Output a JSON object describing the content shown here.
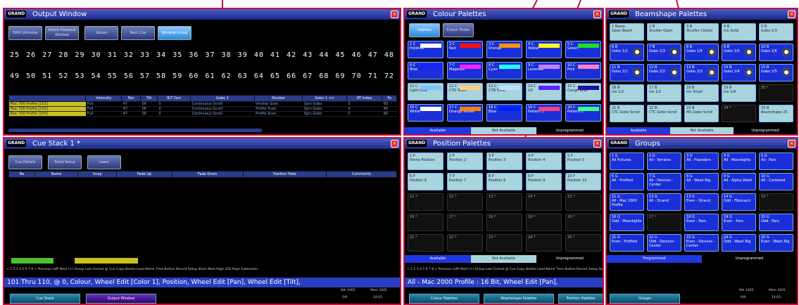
{
  "output_window": {
    "title": "Output Window",
    "logo": "GRAND",
    "tabs": [
      "DMX Universe",
      "Active Playback Window",
      "Values",
      "Next Cue",
      "Window Group"
    ],
    "row1": [
      "25",
      "26",
      "27",
      "28",
      "29",
      "30",
      "31",
      "32",
      "33",
      "34",
      "35",
      "36",
      "37",
      "38",
      "39",
      "40",
      "41",
      "42",
      "43",
      "44",
      "45",
      "46",
      "47",
      "48"
    ],
    "row2": [
      "49",
      "50",
      "51",
      "52",
      "53",
      "54",
      "55",
      "56",
      "57",
      "58",
      "59",
      "60",
      "61",
      "62",
      "63",
      "64",
      "65",
      "66",
      "67",
      "68",
      "69",
      "70",
      "71",
      "72"
    ],
    "sheet_headers": [
      "",
      "Intensity",
      "Pan",
      "Tilt",
      "R/T Dyn",
      "Gobo 1",
      "Shutter",
      "Gobo 1 <>",
      "RT Index",
      "Fo"
    ],
    "sheet_rows": [
      [
        "Mac 700 Profile [101]",
        "Full",
        "47",
        "56",
        "0",
        "Continuous Scroll",
        "Vivaldo Scan",
        "Spin Gobo",
        "0",
        "60"
      ],
      [
        "Mac 700 Profile [102]",
        "Full",
        "47",
        "56",
        "0",
        "Continuous Scroll",
        "Profile Scan",
        "Spin Gobo",
        "0",
        "60"
      ],
      [
        "Mac 700 Profile [103]",
        "Full",
        "47",
        "56",
        "0",
        "Continuous Scroll",
        "Profile Scan",
        "Spin Gobo",
        "0",
        "60"
      ]
    ]
  },
  "cue_stack": {
    "title": "Cue Stack 1 *",
    "tabs": [
      "Cue Details",
      "Store Setup",
      "Learn"
    ],
    "headers": [
      "No",
      "Name",
      "Snap",
      "Fade Up",
      "Fade Down",
      "Position Fade",
      "Comments"
    ],
    "keyline": "< 1 2 3 4 5 6 7 8 > Previous (off) Next (>) Group Last Format @ Cue Copy Delete Load Name Time Button Record Setup Stack Next Page LED Page Submaster",
    "command_line": "101 Thru 110, @ 0, Colour, Wheel Edit [Color 1], Position, Wheel Edit [Pan], Wheel Edit [Tilt],",
    "status1": "6th 1005",
    "status2": "Mem 1001",
    "status3": "0/9",
    "status4": "14:03",
    "bottom_tabs": [
      "Cue Stack",
      "Output Window"
    ]
  },
  "colour_palettes": {
    "title": "Colour Palettes",
    "tabs": [
      "Palettes",
      "Colour Picker"
    ],
    "tiles": [
      {
        "label": "1 C\nPolished",
        "color": "#ffffff"
      },
      {
        "label": "2 C\nRed",
        "color": "#ff1010"
      },
      {
        "label": "3 C\nOrange",
        "color": "#ff9010"
      },
      {
        "label": "4 C\nYellow",
        "color": "#ffff20"
      },
      {
        "label": "5 C\nGreen",
        "color": "#20e020"
      },
      {
        "label": "6 C\nBlue",
        "color": "#2020ff"
      },
      {
        "label": "7 C\nMagenta",
        "color": "#ff20ff"
      },
      {
        "label": "8 C\nCyan",
        "color": "#20ffff"
      },
      {
        "label": "9 C\nLavender",
        "color": "#c080ff"
      },
      {
        "label": "10 C\nPink",
        "color": "#ff80c0"
      },
      {
        "label": "11 C\nLight Blue",
        "color": "#80c0ff"
      },
      {
        "label": "12 C\nCTO 3200",
        "color": "#ffcc80"
      },
      {
        "label": "13 C\nCTB 5600",
        "color": "#c0e0ff"
      },
      {
        "label": "14 C\nUV",
        "color": "#6020ff"
      },
      {
        "label": "15 C\nCongo Blue",
        "color": "#2010a0"
      },
      {
        "label": "16 C\nWhite",
        "color": "#ffffff"
      },
      {
        "label": "17 C\nOrange Wheel",
        "color": "#ff8000"
      },
      {
        "label": "18 C\nBlue",
        "color": "#0020ff"
      },
      {
        "label": "19 C\nPattern 1",
        "color": "#ff4080"
      },
      {
        "label": "20 C\nPattern 2",
        "color": "#40ff80"
      }
    ],
    "avail": [
      "Available",
      "Not Available",
      "Unprogrammed"
    ]
  },
  "beamshape_palettes": {
    "title": "Beamshape Palettes",
    "tiles": [
      "1 Beam\nOpen Beam",
      "2 B\nShutter Open",
      "3 B\nShutter Closed",
      "4 B\nIris Solid",
      "5 B\nGobo 1/3",
      "6 B\nGobo 1/2",
      "7 B\nGobo 1/3",
      "8 B\nGobo 1/4",
      "9 B\nGobo 1/5",
      "10 B\nGobo 1/6",
      "11 B\nGobo 2/1",
      "12 B\nGobo 2/2",
      "13 B\nGobo 2/3",
      "14 B\nGobo 2/4",
      "15 B\nGobo 2/5",
      "16 B\nIris 1/2",
      "17 B\nIris 1/2",
      "18 B\nIris Small",
      "19 B\nIris 1/4",
      "20 *",
      "21 B\nCTC Gobo Scroll",
      "22 B\nCTC Gobo Scroll",
      "23 B\nMS Gobo Scroll",
      "24 *",
      "25 B\nBeamshape 25"
    ],
    "avail": [
      "Available",
      "Not Available",
      "Unprogrammed"
    ]
  },
  "position_palettes": {
    "title": "Position Palettes",
    "tiles": [
      "1 P\nHome Position",
      "2 P\nPosition 2",
      "3 P\nPosition 3",
      "4 P\nPosition 4",
      "5 P\nPosition 5",
      "6 P\nPosition 6",
      "7 P\nPosition 7",
      "8 P\nPosition 8",
      "9 P\nPosition 9",
      "10 P\nPosition 10",
      "11 *",
      "12 *",
      "13 *",
      "14 *",
      "15 *",
      "16 *",
      "17 *",
      "18 *",
      "19 *",
      "20 *",
      "21 *",
      "22 *",
      "23 *",
      "24 *",
      "25 *"
    ],
    "avail": [
      "Available",
      "Not Available",
      "Unprogrammed"
    ],
    "command_line": "All - Mac 2000 Profile : 16 Bit, Wheel Edit [Pan],",
    "keyline": "< 1 2 3 4 5 6 7 8 > Previous (off) Next (>) Group Last Format @ Cue Copy Delete Load Name Time Button Record Setup Stack Next Page LED Page Submaster Update Shape Palettes Position Palettes Effect Palettes",
    "bottom_tabs": [
      "Colour Palettes",
      "Beamshape Palettes",
      "Position Palettes",
      "Groups"
    ]
  },
  "groups": {
    "title": "Groups",
    "tiles": [
      "1 G\nAll Fixtures",
      "2 G\nAll - Terrains",
      "3 G\nAll - Flipsiders",
      "4 G\nAll - Moonlights",
      "5 G\nAll - Pars",
      "6 G\nAll - Profiled",
      "7 G\nAll - Devices - Center",
      "8 G\nAll - Wash Rig",
      "9 G\nAll - Alpha Wash",
      "10 G\nAll - Centered",
      "11 G\nAll - Mac 2000 Profile",
      "12 G\nAll - Strand",
      "13 G\nEven - Strand",
      "14 G\nOdd - Fibonacci",
      "15 *",
      "16 G\nOdd - Moonlights",
      "17 *",
      "18 G\nEven - Pars",
      "19 G\nEven - Pars",
      "20 G\nOdd - Pars",
      "21 G\nEven - Profiled",
      "22 G\nOdd - Devices - Center",
      "23 G\nEven - Devices - Center",
      "24 G\nOdd - Wash Rig",
      "25 G\nEven - Wash Rig"
    ],
    "avail": [
      "Programmed",
      "Unprogrammed"
    ],
    "status1": "6th 1005",
    "status2": "Mem 1001",
    "status3": "0/9",
    "status4": "14:03"
  }
}
